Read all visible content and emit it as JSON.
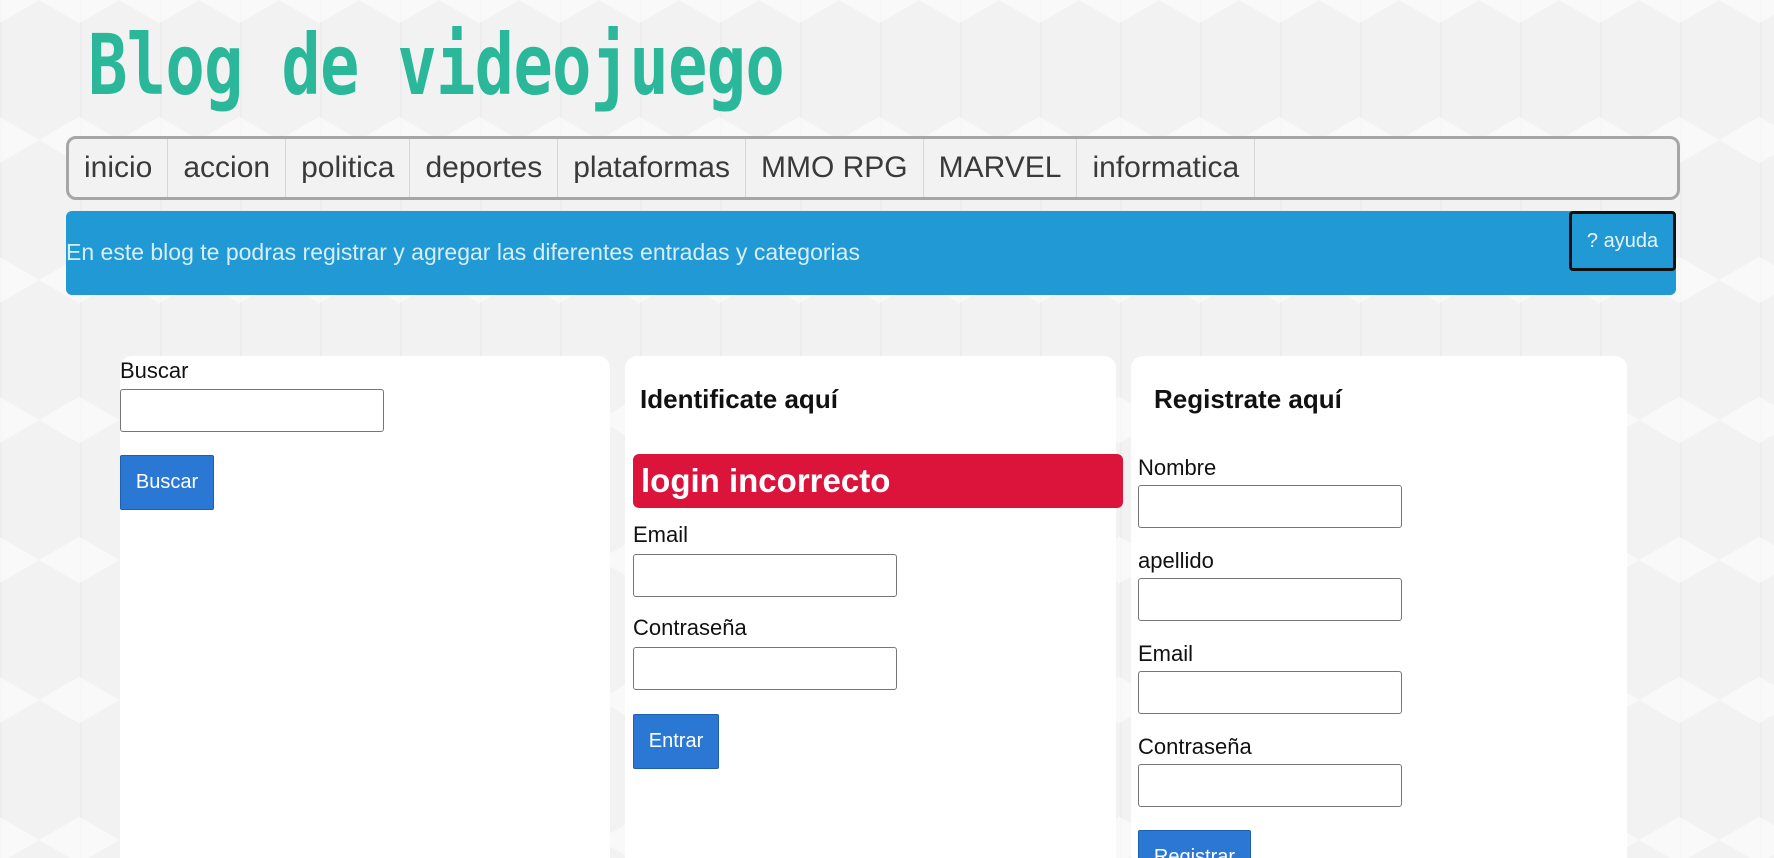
{
  "header": {
    "site_title": "Blog de videojuego"
  },
  "nav": {
    "items": [
      {
        "label": "inicio"
      },
      {
        "label": "accion"
      },
      {
        "label": "politica"
      },
      {
        "label": "deportes"
      },
      {
        "label": "plataformas"
      },
      {
        "label": "MMO RPG"
      },
      {
        "label": "MARVEL"
      },
      {
        "label": "informatica"
      }
    ]
  },
  "banner": {
    "text": "En este blog te podras registrar y agregar las diferentes entradas y categorias",
    "help_label": "? ayuda",
    "color": "#2199d4"
  },
  "search": {
    "label": "Buscar",
    "input_value": "",
    "button_label": "Buscar"
  },
  "login": {
    "heading": "Identificate aquí",
    "error_message": "login incorrecto",
    "email_label": "Email",
    "email_value": "",
    "password_label": "Contraseña",
    "password_value": "",
    "submit_label": "Entrar",
    "error_color": "#dc143c"
  },
  "register": {
    "heading": "Registrate aquí",
    "name_label": "Nombre",
    "name_value": "",
    "lastname_label": "apellido",
    "lastname_value": "",
    "email_label": "Email",
    "email_value": "",
    "password_label": "Contraseña",
    "password_value": "",
    "submit_label": "Registrar"
  },
  "colors": {
    "accent_title": "#2bb89a",
    "button_blue": "#2a78d4"
  }
}
